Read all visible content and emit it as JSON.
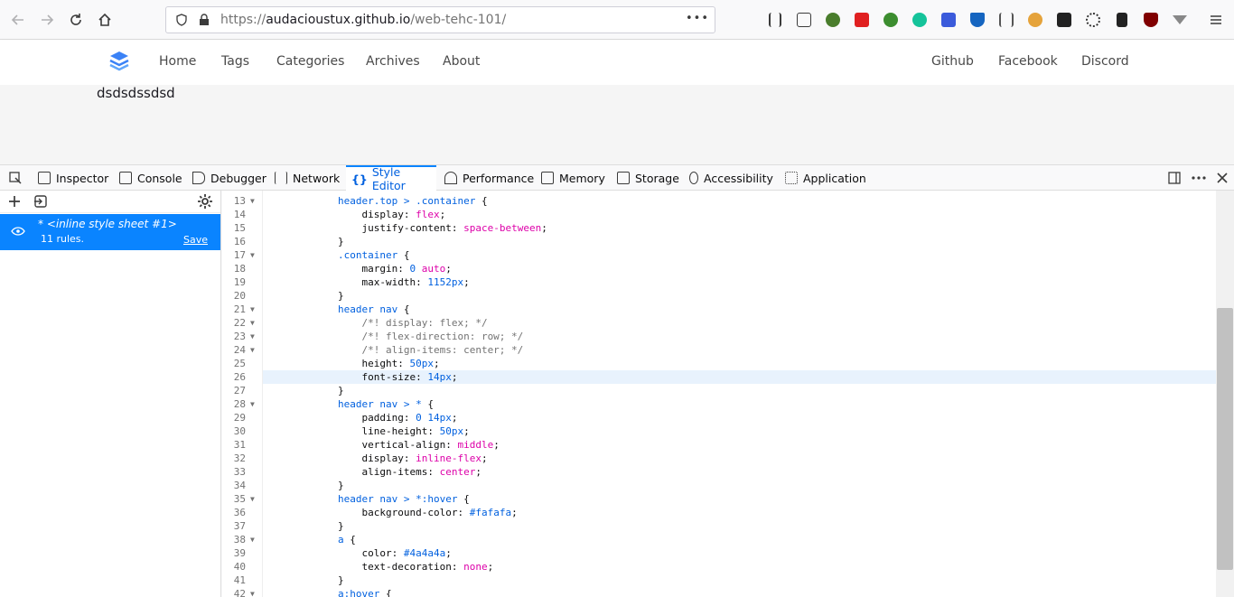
{
  "browser": {
    "url_scheme": "https://",
    "url_host": "audacioustux.github.io",
    "url_path": "/web-tehc-101/",
    "more_label": "•••"
  },
  "site": {
    "nav_left": [
      "Home",
      "Tags",
      "Categories",
      "Archives",
      "About"
    ],
    "nav_right": [
      "Github",
      "Facebook",
      "Discord"
    ],
    "body_text": "dsdsdssdsd"
  },
  "devtools": {
    "tabs": [
      "Inspector",
      "Console",
      "Debugger",
      "Network",
      "Style Editor",
      "Performance",
      "Memory",
      "Storage",
      "Accessibility",
      "Application"
    ],
    "active_tab": "Style Editor",
    "sheet": {
      "name": "* <inline style sheet #1>",
      "rules": "11 rules.",
      "save_label": "Save"
    },
    "lines": [
      {
        "n": "13",
        "fold": true,
        "text": "header.top > .container {"
      },
      {
        "n": "14",
        "fold": false,
        "text": "    display: flex;"
      },
      {
        "n": "15",
        "fold": false,
        "text": "    justify-content: space-between;"
      },
      {
        "n": "16",
        "fold": false,
        "text": "}"
      },
      {
        "n": "17",
        "fold": true,
        "text": ".container {"
      },
      {
        "n": "18",
        "fold": false,
        "text": "    margin: 0 auto;"
      },
      {
        "n": "19",
        "fold": false,
        "text": "    max-width: 1152px;"
      },
      {
        "n": "20",
        "fold": false,
        "text": "}"
      },
      {
        "n": "21",
        "fold": true,
        "text": "header nav {"
      },
      {
        "n": "22",
        "fold": true,
        "text": "    /*! display: flex; */"
      },
      {
        "n": "23",
        "fold": true,
        "text": "    /*! flex-direction: row; */"
      },
      {
        "n": "24",
        "fold": true,
        "text": "    /*! align-items: center; */"
      },
      {
        "n": "25",
        "fold": false,
        "text": "    height: 50px;"
      },
      {
        "n": "26",
        "fold": false,
        "text": "    font-size: 14px;"
      },
      {
        "n": "27",
        "fold": false,
        "text": "}"
      },
      {
        "n": "28",
        "fold": true,
        "text": "header nav > * {"
      },
      {
        "n": "29",
        "fold": false,
        "text": "    padding: 0 14px;"
      },
      {
        "n": "30",
        "fold": false,
        "text": "    line-height: 50px;"
      },
      {
        "n": "31",
        "fold": false,
        "text": "    vertical-align: middle;"
      },
      {
        "n": "32",
        "fold": false,
        "text": "    display: inline-flex;"
      },
      {
        "n": "33",
        "fold": false,
        "text": "    align-items: center;"
      },
      {
        "n": "34",
        "fold": false,
        "text": "}"
      },
      {
        "n": "35",
        "fold": true,
        "text": "header nav > *:hover {"
      },
      {
        "n": "36",
        "fold": false,
        "text": "    background-color: #fafafa;"
      },
      {
        "n": "37",
        "fold": false,
        "text": "}"
      },
      {
        "n": "38",
        "fold": true,
        "text": "a {"
      },
      {
        "n": "39",
        "fold": false,
        "text": "    color: #4a4a4a;"
      },
      {
        "n": "40",
        "fold": false,
        "text": "    text-decoration: none;"
      },
      {
        "n": "41",
        "fold": false,
        "text": "}"
      },
      {
        "n": "42",
        "fold": true,
        "text": "a:hover {"
      }
    ],
    "active_line": "26"
  }
}
